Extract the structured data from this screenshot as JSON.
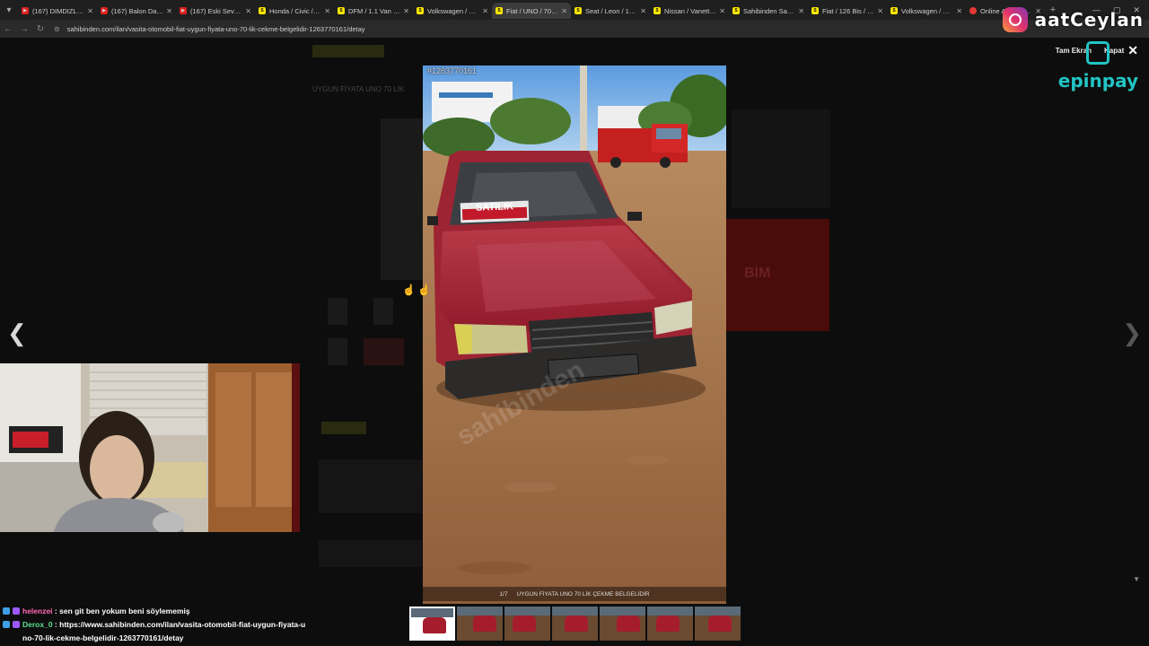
{
  "tabs": [
    {
      "title": "(167) DIMDIZLAK H",
      "icon": "youtube-icon",
      "kind": "yt"
    },
    {
      "title": "(167) Balon Date S",
      "icon": "youtube-icon",
      "kind": "yt"
    },
    {
      "title": "(167) Eski Sevgilin",
      "icon": "youtube-icon",
      "kind": "yt"
    },
    {
      "title": "Honda / Civic / 1.6",
      "icon": "sahibinden-icon",
      "kind": "sh"
    },
    {
      "title": "DFM / 1.1 Van / PE",
      "icon": "sahibinden-icon",
      "kind": "sh"
    },
    {
      "title": "Volkswagen / Scirc",
      "icon": "sahibinden-icon",
      "kind": "sh"
    },
    {
      "title": "Fiat / UNO / 70 SX",
      "icon": "sahibinden-icon",
      "kind": "sh",
      "active": true
    },
    {
      "title": "Seat / Leon / 1.5 E",
      "icon": "sahibinden-icon",
      "kind": "sh"
    },
    {
      "title": "Nissan / Vanette / 2",
      "icon": "sahibinden-icon",
      "kind": "sh"
    },
    {
      "title": "Sahibinden Satılık ",
      "icon": "sahibinden-icon",
      "kind": "sh"
    },
    {
      "title": "Fiat / 126 Bis / 126",
      "icon": "sahibinden-icon",
      "kind": "sh"
    },
    {
      "title": "Volkswagen / Polo",
      "icon": "sahibinden-icon",
      "kind": "sh"
    },
    {
      "title": "Online Alışveriş Site",
      "icon": "chrome-icon",
      "kind": "ch"
    }
  ],
  "address": {
    "url": "sahibinden.com/ilan/vasita-otomobil-fiat-uygun-fiyata-uno-70-lik-cekme-belgelidir-1263770161/detay"
  },
  "gallery": {
    "listing_id": "#1263770161",
    "counter": "1/7",
    "caption": "UYGUN FİYATA UNO 70 LİK ÇEKME BELGELİDİR",
    "fullscreen_label": "Tam Ekran",
    "close_label": "Kapat",
    "thumb_count": 7,
    "active_thumb": 1
  },
  "overlay": {
    "instagram_name": "aatCeylan",
    "sponsor": "epinpay"
  },
  "photo": {
    "sign_text": "SATILIK",
    "watermark": "sahibinden"
  },
  "chat": [
    {
      "user": "helenzei",
      "message": "sen git ben yokum beni söylememiş"
    },
    {
      "user": "Derox_0",
      "message": "https://www.sahibinden.com/ilan/vasita-otomobil-fiat-uygun-fiyata-uno-70-lik-cekme-belgelidir-1263770161/detay"
    }
  ],
  "background_page": {
    "title_ghost": "UYGUN FİYATA UNO 70 LİK",
    "bim": "BİM"
  },
  "colors": {
    "car": "#a51d2d",
    "sahibinden": "#ffe800",
    "epinpay": "#22c4c4"
  }
}
